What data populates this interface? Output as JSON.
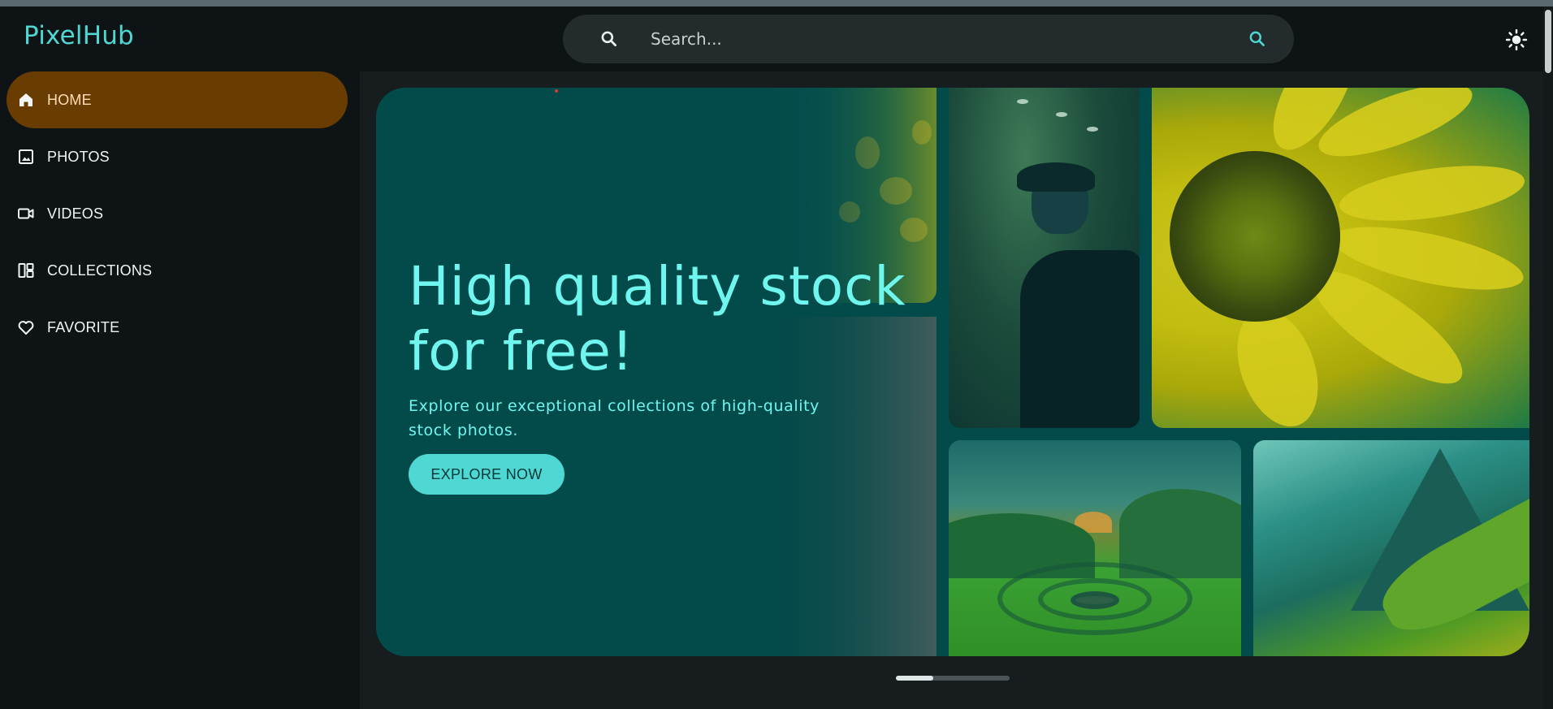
{
  "app": {
    "title": "PixelHub"
  },
  "search": {
    "placeholder": "Search...",
    "value": "",
    "lead_icon": "search-icon",
    "trail_icon": "search-icon"
  },
  "header": {
    "theme_toggle_icon": "sun-icon"
  },
  "sidebar": {
    "items": [
      {
        "label": "HOME",
        "icon": "home-icon",
        "active": true
      },
      {
        "label": "PHOTOS",
        "icon": "image-icon",
        "active": false
      },
      {
        "label": "VIDEOS",
        "icon": "video-camera-icon",
        "active": false
      },
      {
        "label": "COLLECTIONS",
        "icon": "dashboard-icon",
        "active": false
      },
      {
        "label": "FAVORITE",
        "icon": "heart-icon",
        "active": false
      }
    ]
  },
  "hero": {
    "title": "High quality stock for free!",
    "subtitle": "Explore our exceptional collections of high-quality stock photos.",
    "cta_label": "EXPLORE NOW",
    "images": [
      "flowers-photo",
      "man-in-cap-photo",
      "sunflower-photo",
      "green-valley-photo",
      "mountain-photo"
    ]
  },
  "carousel": {
    "pages": 3,
    "current": 1
  },
  "colors": {
    "accent": "#4fd8d3",
    "active_nav": "#693d02",
    "hero_bg": "#034a4a",
    "hero_text": "#6ff6ee",
    "background": "#0e1416"
  }
}
